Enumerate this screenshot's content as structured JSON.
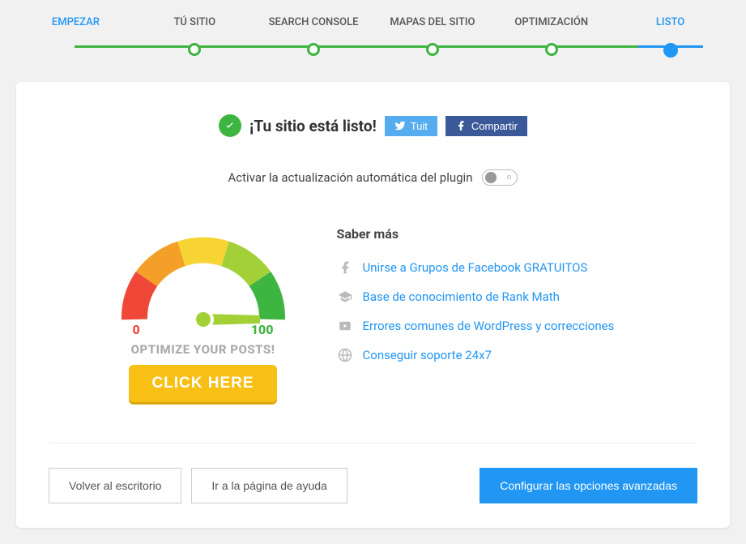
{
  "stepper": {
    "steps": [
      {
        "label": "EMPEZAR"
      },
      {
        "label": "TÚ SITIO"
      },
      {
        "label": "SEARCH CONSOLE"
      },
      {
        "label": "MAPAS DEL SITIO"
      },
      {
        "label": "OPTIMIZACIÓN"
      },
      {
        "label": "LISTO"
      }
    ]
  },
  "header": {
    "title": "¡Tu sitio está listo!",
    "twitter_label": "Tuit",
    "facebook_label": "Compartir"
  },
  "auto_update": {
    "label": "Activar la actualización automática del plugin",
    "enabled": false
  },
  "gauge": {
    "min": "0",
    "max": "100",
    "optimize_text": "OPTIMIZE YOUR POSTS!",
    "cta_label": "CLICK HERE"
  },
  "learn_more": {
    "title": "Saber más",
    "items": [
      {
        "icon": "facebook-icon",
        "label": "Unirse a Grupos de Facebook GRATUITOS"
      },
      {
        "icon": "graduation-icon",
        "label": "Base de conocimiento de Rank Math"
      },
      {
        "icon": "play-icon",
        "label": "Errores comunes de WordPress y correcciones"
      },
      {
        "icon": "globe-icon",
        "label": "Conseguir soporte 24x7"
      }
    ]
  },
  "footer": {
    "dashboard_label": "Volver al escritorio",
    "help_label": "Ir a la página de ayuda",
    "advanced_label": "Configurar las opciones avanzadas"
  }
}
